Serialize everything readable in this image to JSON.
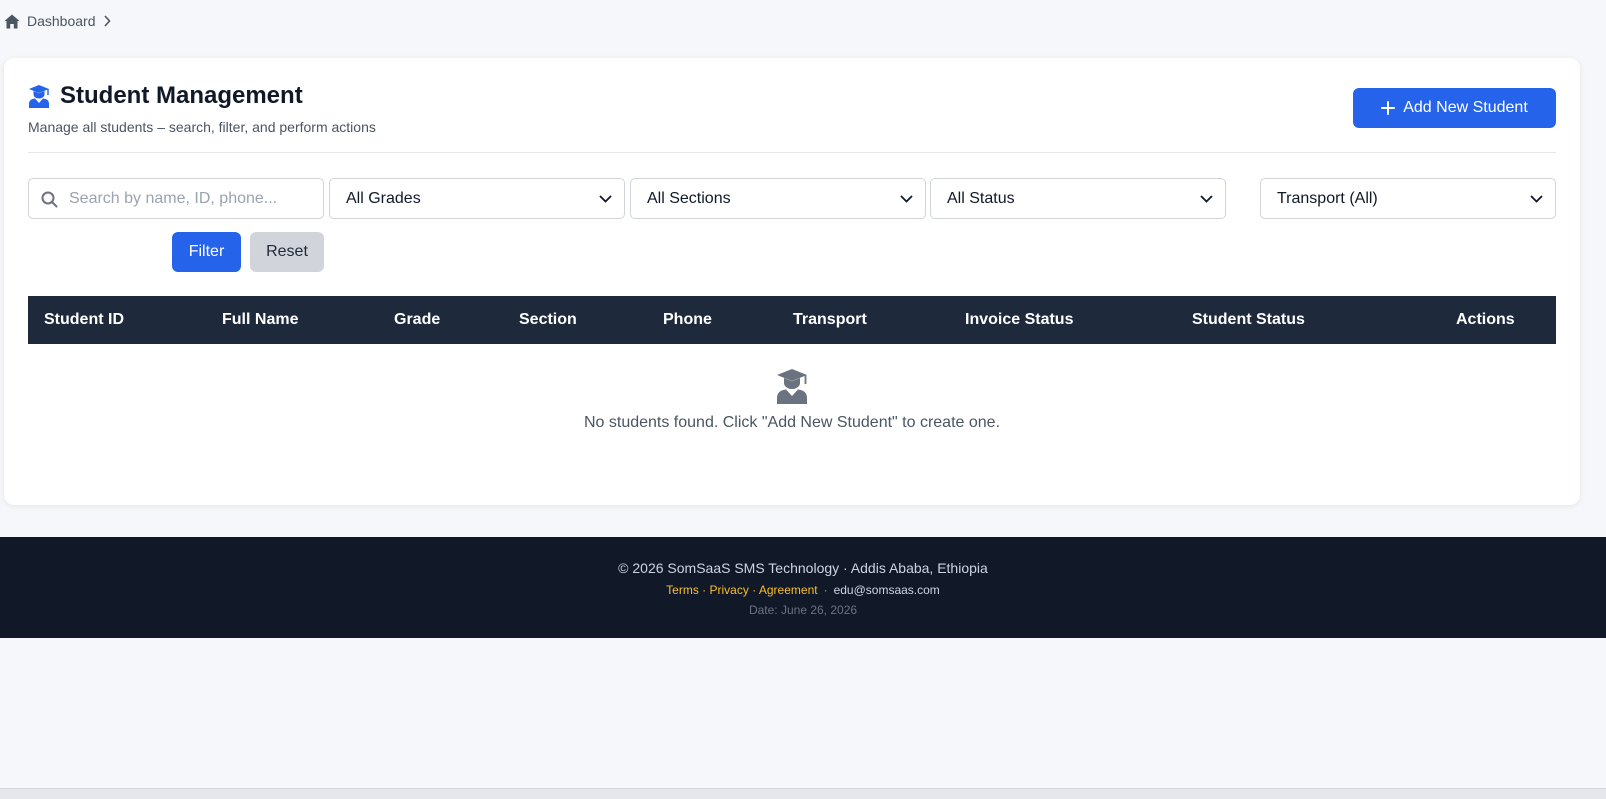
{
  "breadcrumb": {
    "home_label": "Dashboard"
  },
  "header": {
    "title": "Student Management",
    "subtitle": "Manage all students – search, filter, and perform actions",
    "add_button_label": "Add New Student"
  },
  "filters": {
    "search_placeholder": "Search by name, ID, phone...",
    "grade_selected": "All Grades",
    "section_selected": "All Sections",
    "status_selected": "All Status",
    "transport_selected": "Transport (All)",
    "filter_label": "Filter",
    "reset_label": "Reset"
  },
  "table": {
    "columns": [
      "Student ID",
      "Full Name",
      "Grade",
      "Section",
      "Phone",
      "Transport",
      "Invoice Status",
      "Student Status",
      "Actions"
    ],
    "rows": [],
    "empty_message": "No students found. Click \"Add New Student\" to create one."
  },
  "footer": {
    "copyright": "© 2026 SomSaaS SMS Technology · Addis Ababa, Ethiopia",
    "links": [
      "Terms",
      "Privacy",
      "Agreement"
    ],
    "email": "edu@somsaas.com",
    "date": "Date: June 26, 2026"
  },
  "colors": {
    "accent": "#2563eb",
    "table_header": "#1e293b",
    "footer_bg": "#111827",
    "footer_link": "#fbbf24"
  }
}
